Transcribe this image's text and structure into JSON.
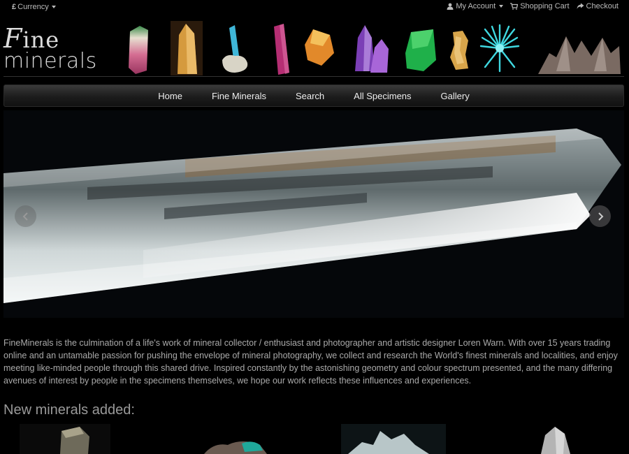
{
  "topbar": {
    "currency_symbol": "£",
    "currency_label": "Currency",
    "my_account": "My Account",
    "shopping_cart": "Shopping Cart",
    "checkout": "Checkout"
  },
  "brand": {
    "line1_initial": "F",
    "line1_rest": "ine",
    "line2": "minerals"
  },
  "nav": {
    "items": [
      "Home",
      "Fine Minerals",
      "Search",
      "All Specimens",
      "Gallery"
    ]
  },
  "intro": {
    "text": "FineMinerals is the culmination of a life's work of mineral collector / enthusiast and photographer and artistic designer Loren Warn. With over 15 years trading online and an untamable passion for pushing the envelope of mineral photography, we collect and research the World's finest minerals and localities, and enjoy meeting like-minded people through this shared drive. Inspired constantly by the astonishing geometry and colour spectrum presented, and the many differing avenues of interest by people in the specimens themselves, we hope our work reflects these influences and experiences."
  },
  "new_minerals": {
    "title": "New minerals added:"
  },
  "colors": {
    "background": "#000000",
    "nav_gradient_top": "#3a3a3a",
    "nav_gradient_bottom": "#111111",
    "text": "#aaaaaa"
  },
  "icons": {
    "currency": "pound-sign",
    "account": "user-icon",
    "cart": "cart-icon",
    "checkout": "share-arrow-icon",
    "slide_prev": "chevron-left-icon",
    "slide_next": "chevron-right-icon"
  }
}
